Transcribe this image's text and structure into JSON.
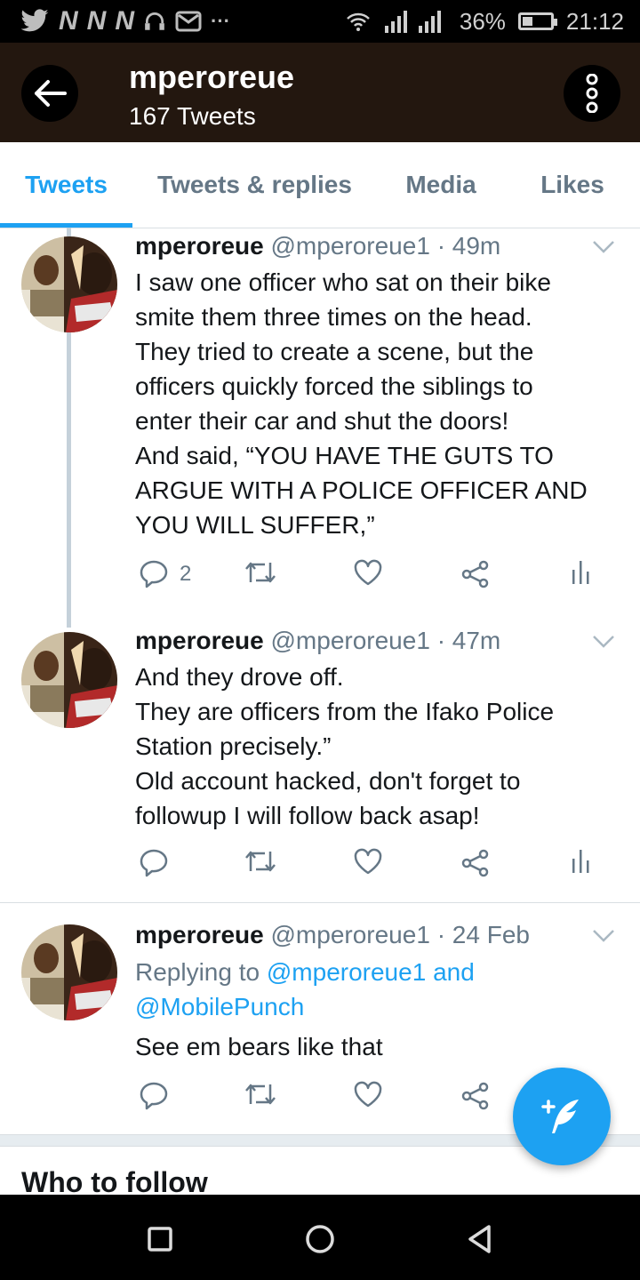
{
  "status_bar": {
    "left_icons": [
      "twitter-icon",
      "n-icon",
      "n-icon",
      "n-icon",
      "headset-icon",
      "mail-icon",
      "more-icon"
    ],
    "battery": "36%",
    "battery_level": 0.36,
    "time": "21:12"
  },
  "header": {
    "title": "mperoreue",
    "subtitle": "167 Tweets"
  },
  "tabs": [
    {
      "label": "Tweets",
      "active": true
    },
    {
      "label": "Tweets & replies",
      "active": false
    },
    {
      "label": "Media",
      "active": false
    },
    {
      "label": "Likes",
      "active": false
    }
  ],
  "tweets": [
    {
      "name": "mperoreue",
      "handle": "@mperoreue1",
      "time": "· 49m",
      "lines": [
        "I saw one officer who sat on their bike",
        "smite them three times on the head.",
        "They tried to create a scene, but the",
        "officers quickly forced the siblings to",
        "enter their car and shut the doors!",
        "And said, “YOU HAVE THE GUTS TO",
        "ARGUE WITH A POLICE OFFICER AND",
        "YOU WILL SUFFER,”"
      ],
      "reply_count": "2"
    },
    {
      "name": "mperoreue",
      "handle": "@mperoreue1",
      "time": "· 47m",
      "lines": [
        "And they drove off.",
        "They are officers from the Ifako Police",
        "Station precisely.”",
        "Old account hacked, don't forget to",
        "followup I will follow back asap!"
      ],
      "reply_count": ""
    },
    {
      "name": "mperoreue",
      "handle": "@mperoreue1",
      "time": "· 24 Feb",
      "replying_prefix": "Replying to",
      "replying_user1": "@mperoreue1",
      "replying_and": "and",
      "replying_user2": "@MobilePunch",
      "lines": [
        "See em bears like that"
      ],
      "reply_count": ""
    }
  ],
  "who_to_follow": "Who to follow",
  "colors": {
    "accent": "#1da1f2",
    "header_bg": "#23170f",
    "secondary_text": "#657786"
  }
}
